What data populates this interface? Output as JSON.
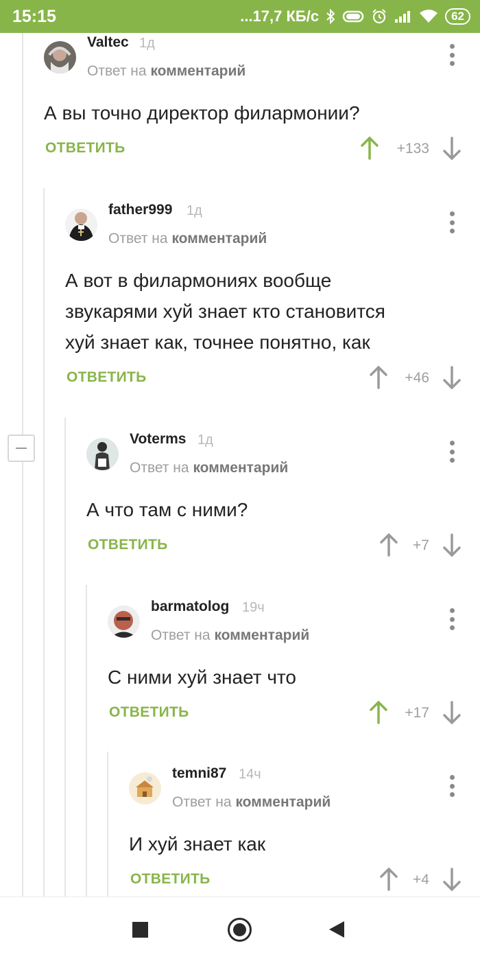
{
  "status_bar": {
    "time": "15:15",
    "net_speed": "...17,7 КБ/с",
    "battery": "62",
    "bg_color": "#88b54a"
  },
  "colors": {
    "accent": "#88b54a",
    "upvoted": "#88b54a",
    "neutral_arrow": "#9a9a9a",
    "muted_text": "#9e9e9e"
  },
  "comments": [
    {
      "author": "Valtec",
      "time": "1д",
      "reply_prefix": "Ответ на",
      "reply_target": "комментарий",
      "text_lines": [
        "А вы точно директор филармонии?"
      ],
      "reply_label": "ОТВЕТИТЬ",
      "score": "+133",
      "upvoted": true
    },
    {
      "author": "father999",
      "time": "1д",
      "reply_prefix": "Ответ на",
      "reply_target": "комментарий",
      "text_lines": [
        "А вот в филармониях вообще",
        "звукарями хуй знает кто становится",
        "хуй знает как, точнее понятно, как"
      ],
      "reply_label": "ОТВЕТИТЬ",
      "score": "+46",
      "upvoted": false
    },
    {
      "author": "Voterms",
      "time": "1д",
      "reply_prefix": "Ответ на",
      "reply_target": "комментарий",
      "text_lines": [
        "А что там с ними?"
      ],
      "reply_label": "ОТВЕТИТЬ",
      "score": "+7",
      "upvoted": false
    },
    {
      "author": "barmatolog",
      "time": "19ч",
      "reply_prefix": "Ответ на",
      "reply_target": "комментарий",
      "text_lines": [
        "С ними хуй знает что"
      ],
      "reply_label": "ОТВЕТИТЬ",
      "score": "+17",
      "upvoted": true
    },
    {
      "author": "temni87",
      "time": "14ч",
      "reply_prefix": "Ответ на",
      "reply_target": "комментарий",
      "text_lines": [
        "И хуй знает как"
      ],
      "reply_label": "ОТВЕТИТЬ",
      "score": "+4",
      "upvoted": false
    }
  ],
  "nav": {
    "icons": [
      "recents-square-icon",
      "home-circle-icon",
      "back-triangle-icon"
    ]
  }
}
